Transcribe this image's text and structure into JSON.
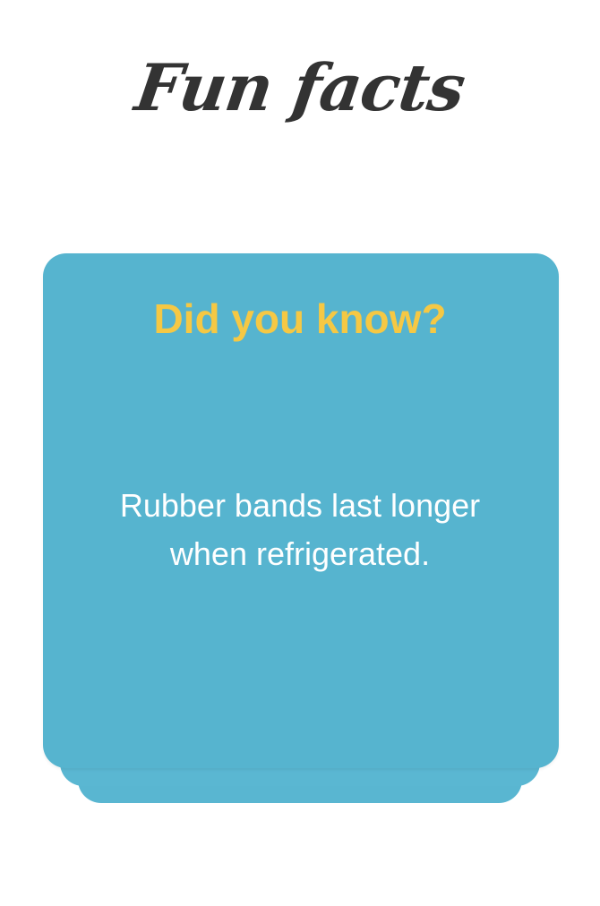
{
  "header": {
    "title": "Fun facts"
  },
  "card": {
    "heading": "Did you know?",
    "fact": "Rubber bands last longer when refrigerated."
  },
  "colors": {
    "card_front": "#56b4cf",
    "card_back_1": "#5ab7d2",
    "card_back_2": "#59b6d1",
    "heading": "#f5c844",
    "title": "#333333"
  }
}
